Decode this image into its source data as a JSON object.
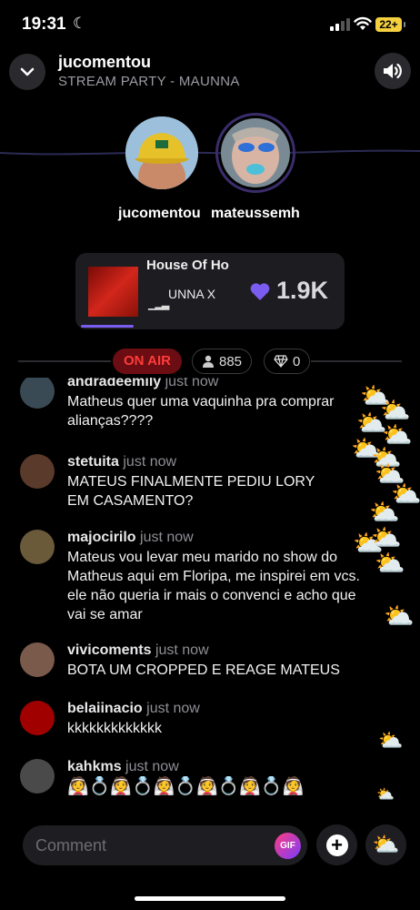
{
  "status_bar": {
    "time": "19:31",
    "battery": "22+"
  },
  "header": {
    "title": "jucomentou",
    "subtitle": "STREAM PARTY - MAUNNA"
  },
  "hosts": [
    {
      "name": "jucomentou",
      "avatar": "yellow-cap-avatar"
    },
    {
      "name": "mateussemh",
      "avatar": "blue-makeup-avatar"
    }
  ],
  "now_playing": {
    "title": "House Of Ho",
    "artist": "UNNA X",
    "likes": "1.9K",
    "progress": 0.2
  },
  "stream_status": {
    "on_air": "ON AIR",
    "listeners": "885",
    "diamonds": "0"
  },
  "comments": [
    {
      "username": "andradeemily",
      "time": "just now",
      "text": "Matheus quer uma vaquinha pra comprar\nalianças????",
      "avatar_color": "#3a4a55"
    },
    {
      "username": "stetuita",
      "time": "just now",
      "text": "MATEUS FINALMENTE PEDIU LORY\nEM CASAMENTO?",
      "avatar_color": "#5a3a2a"
    },
    {
      "username": "majocirilo",
      "time": "just now",
      "text": "Mateus vou levar meu marido no show do\nMatheus aqui em Floripa, me inspirei em vcs.\nele não queria ir mais o convenci e acho que\nvai se amar",
      "avatar_color": "#6a5a3a"
    },
    {
      "username": "vivicoments",
      "time": "just now",
      "text": "BOTA UM CROPPED E REAGE MATEUS",
      "avatar_color": "#7a5a4a"
    },
    {
      "username": "belaiinacio",
      "time": "just now",
      "text": "kkkkkkkkkkkkk",
      "avatar_color": "#a00000"
    },
    {
      "username": "kahkms",
      "time": "just now",
      "text": "👰💍👰💍👰💍👰💍👰💍👰",
      "avatar_color": "#4a4a4a"
    }
  ],
  "input": {
    "placeholder": "Comment",
    "gif_label": "GIF"
  },
  "reaction_emoji": "⛅",
  "colors": {
    "accent": "#7b5cf0",
    "on_air_bg": "#6b0d12",
    "on_air_text": "#ff3b3b"
  }
}
